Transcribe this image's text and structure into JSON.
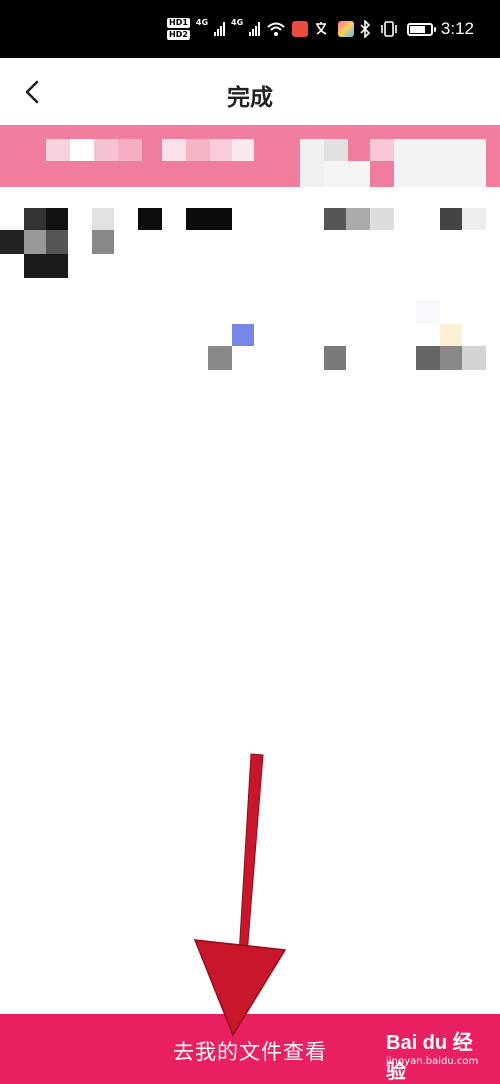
{
  "status_bar": {
    "hd1": "HD1",
    "hd2": "HD2",
    "network1": "4G",
    "network2": "4G",
    "time": "3:12"
  },
  "header": {
    "title": "完成",
    "back_icon": "chevron-left-icon"
  },
  "bottom_action": {
    "label": "去我的文件查看"
  },
  "watermark": {
    "brand": "Bai du 经验",
    "url": "jingyan.baidu.com"
  },
  "colors": {
    "status_bar_bg": "#000000",
    "banner": "#f17d9e",
    "bottom_button": "#e8205f",
    "arrow": "#c8172b"
  }
}
